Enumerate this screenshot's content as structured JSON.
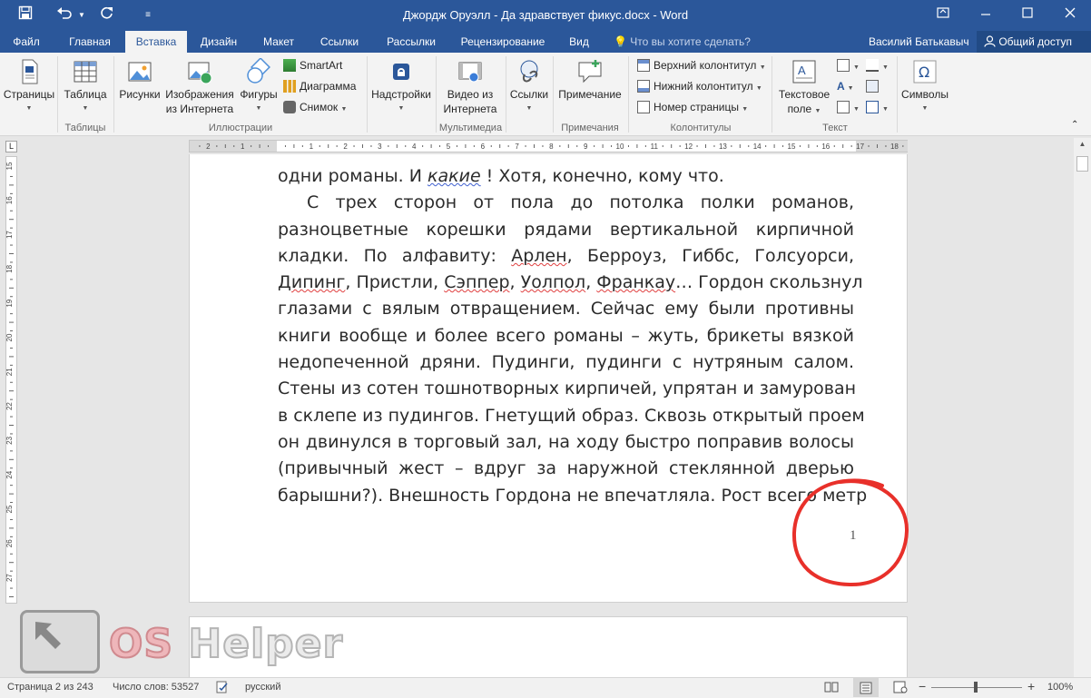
{
  "window": {
    "title": "Джордж Оруэлл - Да здравствует фикус.docx - Word",
    "controls": [
      "restore-icon",
      "minimize-icon",
      "maximize-icon",
      "close-icon"
    ]
  },
  "quick_access": {
    "save": "save-icon",
    "undo": "undo-icon",
    "redo": "redo-icon",
    "customize": "customize-icon"
  },
  "menu": {
    "tabs": [
      "Файл",
      "Главная",
      "Вставка",
      "Дизайн",
      "Макет",
      "Ссылки",
      "Рассылки",
      "Рецензирование",
      "Вид"
    ],
    "active_tab": "Вставка",
    "tell_me": "Что вы хотите сделать?",
    "user": "Василий Батькавыч",
    "share": "Общий доступ"
  },
  "ribbon": {
    "pages": "Страницы",
    "table": "Таблица",
    "group_tables": "Таблицы",
    "pictures": "Рисунки",
    "online_pictures_1": "Изображения",
    "online_pictures_2": "из Интернета",
    "shapes": "Фигуры",
    "smartart": "SmartArt",
    "chart": "Диаграмма",
    "screenshot": "Снимок",
    "group_illustrations": "Иллюстрации",
    "addins": "Надстройки",
    "video_1": "Видео из",
    "video_2": "Интернета",
    "group_media": "Мультимедиа",
    "links": "Ссылки",
    "comment": "Примечание",
    "group_comments": "Примечания",
    "header": "Верхний колонтитул",
    "footer": "Нижний колонтитул",
    "page_number": "Номер страницы",
    "group_header_footer": "Колонтитулы",
    "textbox_1": "Текстовое",
    "textbox_2": "поле",
    "group_text": "Текст",
    "symbols": "Символы"
  },
  "ruler": {
    "h_ticks": [
      "2",
      "1",
      "1",
      "2",
      "3",
      "4",
      "5",
      "6",
      "7",
      "8",
      "9",
      "10",
      "11",
      "12",
      "13",
      "14",
      "15",
      "16",
      "17",
      "18"
    ],
    "v_ticks": [
      "15",
      "16",
      "17",
      "18",
      "19",
      "20",
      "21",
      "22",
      "23",
      "24",
      "25",
      "26",
      "27"
    ]
  },
  "document": {
    "line_1a": "одни романы. И ",
    "line_1b": "какие",
    "line_1c": " ! Хотя, конечно, кому что.",
    "line_2": "С трех сторон от пола до потолка полки романов,",
    "line_3": "разноцветные корешки рядами вертикальной кирпичной",
    "line_4a": "кладки. По алфавиту: ",
    "line_4b": "Арлен",
    "line_4c": ", Берроуз, Гиббс, Голсуорси,",
    "line_5a": "Дипинг",
    "line_5b": ", Пристли, ",
    "line_5c": "Сэппер",
    "line_5d": ", ",
    "line_5e": "Уолпол",
    "line_5f": ", ",
    "line_5g": "Франкау",
    "line_5h": "… Гордон скользнул",
    "line_6": "глазами с вялым отвращением. Сейчас ему были противны",
    "line_7": "книги вообще и более всего романы – жуть, брикеты вязкой",
    "line_8": "недопеченной дряни. Пудинги, пудинги с нутряным салом.",
    "line_9": "Стены из сотен тошнотворных кирпичей, упрятан и замурован",
    "line_10": "в склепе из пудингов. Гнетущий образ. Сквозь открытый проем",
    "line_11": "он двинулся в торговый зал, на ходу быстро поправив волосы",
    "line_12": "(привычный жест – вдруг за наружной стеклянной дверью",
    "line_13": "барышни?). Внешность Гордона не впечатляла. Рост всего метр",
    "page_number": "1"
  },
  "watermark": {
    "os": "OS",
    "helper": " Helper"
  },
  "status": {
    "page": "Страница 2 из 243",
    "words": "Число слов: 53527",
    "language": "русский",
    "zoom": "100%"
  },
  "colors": {
    "accent": "#2b579a",
    "annotation": "#e8302a"
  }
}
